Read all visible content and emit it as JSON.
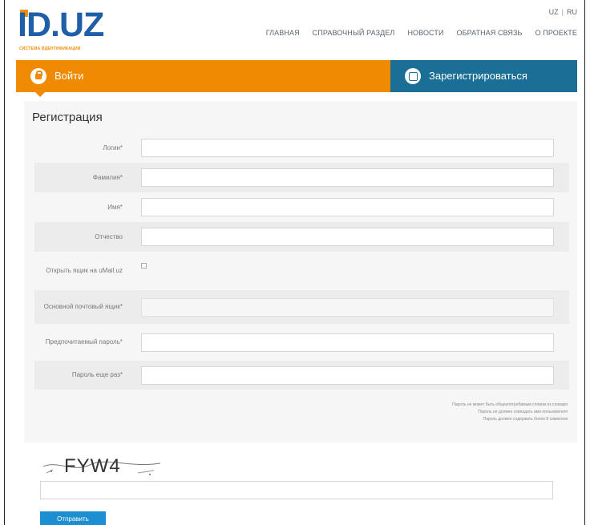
{
  "header": {
    "logo_text": "ID.UZ",
    "logo_subtitle": "СИСТЕМА ИДЕНТИФИКАЦИИ",
    "languages": [
      "UZ",
      "RU"
    ],
    "nav": [
      "ГЛАВНАЯ",
      "СПРАВОЧНЫЙ РАЗДЕЛ",
      "НОВОСТИ",
      "ОБРАТНАЯ СВЯЗЬ",
      "О ПРОЕКТЕ"
    ]
  },
  "auth": {
    "login_label": "Войти",
    "register_label": "Зарегистрироваться",
    "login_color": "#f08a00",
    "register_color": "#1b6f96"
  },
  "page": {
    "title": "Регистрация"
  },
  "form": {
    "fields": [
      {
        "label": "Логин*",
        "value": ""
      },
      {
        "label": "Фамилия*",
        "value": ""
      },
      {
        "label": "Имя*",
        "value": ""
      },
      {
        "label": "Отчество",
        "value": ""
      },
      {
        "label": "Открыть ящик на uMail.uz",
        "value": ""
      },
      {
        "label": "Основной почтовый ящик*",
        "value": ""
      },
      {
        "label": "Предпочитаемый пароль*",
        "value": ""
      },
      {
        "label": "Пароль еще раз*",
        "value": ""
      }
    ],
    "password_hints": [
      "Пароль не может быть общеупотребимым словом из словаря",
      "Пароль не должен совпадать имя пользователя",
      "Пароль должен содержать более 8 символов"
    ],
    "captcha_text": "FYW4",
    "submit_label": "Отправить"
  }
}
